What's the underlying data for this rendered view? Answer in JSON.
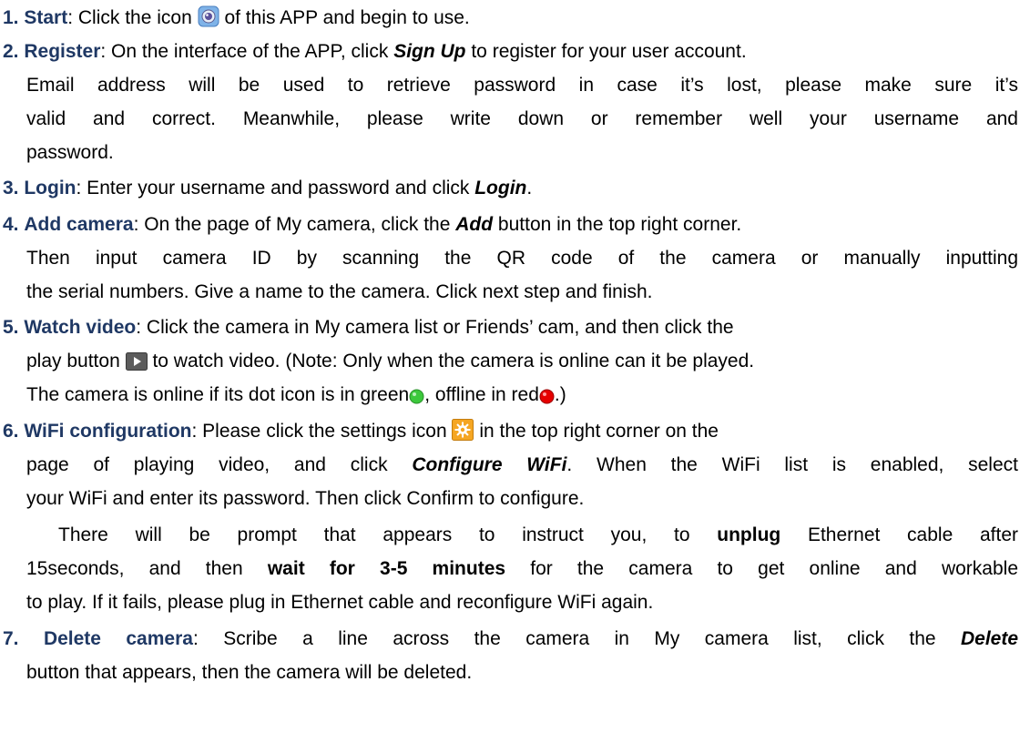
{
  "steps": [
    {
      "num": "1.",
      "label": "Start",
      "text_a": ": Click the icon ",
      "icon": "app-camera-icon",
      "text_b": " of this APP and begin to use."
    },
    {
      "num": "2.",
      "label": "Register",
      "text_a": ": On the interface of the APP, click ",
      "keyword": "Sign Up",
      "text_b": " to register for your user account.",
      "lines": [
        "Email address will be used to retrieve password in case it’s lost, please make sure it’s",
        "valid and correct. Meanwhile, please write down or remember well your username and",
        "password."
      ]
    },
    {
      "num": "3.",
      "label": "Login",
      "text_a": ": Enter your username and password and click ",
      "keyword": "Login",
      "text_b": "."
    },
    {
      "num": "4.",
      "label": "Add camera",
      "text_a": ": On the page of My camera, click the ",
      "keyword": "Add",
      "text_b": " button in the top right corner.",
      "lines": [
        "Then input camera ID by scanning the QR code of the camera or manually inputting",
        "the serial numbers. Give a name to the camera. Click next step and finish."
      ]
    },
    {
      "num": "5.",
      "label": "Watch video",
      "text_a": ": Click the camera in My camera list or Friends’ cam, and then click the",
      "line2_a": "play button ",
      "icon": "play-button-icon",
      "line2_b": " to watch video. (Note: Only when the camera is online can it be played.",
      "line3_a": "The camera is online if its dot icon is in green",
      "icon_green": "green-dot-icon",
      "line3_b": ", offline in red",
      "icon_red": "red-dot-icon",
      "line3_c": ".)"
    },
    {
      "num": "6.",
      "label": "WiFi configuration",
      "text_a": ": Please click the settings icon ",
      "icon": "settings-gear-icon",
      "text_b": " in the top right corner on the",
      "line2_a": "page of playing video, and click ",
      "keyword": "Configure WiFi",
      "line2_b": ". When the WiFi list is enabled, select",
      "line3": "your WiFi and enter its password. Then click Confirm to configure.",
      "para_a": "There will be prompt that appears to instruct you, to ",
      "para_bold1": "unplug",
      "para_b": " Ethernet cable after",
      "para2_a": "15seconds, and then ",
      "para2_bold": "wait for 3-5 minutes",
      "para2_b": " for the camera to get online and workable",
      "para3": "to play. If it fails, please plug in Ethernet cable and reconfigure WiFi again."
    },
    {
      "num": "7.",
      "label": "Delete camera",
      "text_a": ": Scribe a line across the camera in My camera list, click the ",
      "keyword": "Delete",
      "line2": "button that appears, then the camera will be deleted."
    }
  ],
  "colors": {
    "heading": "#1f3864",
    "text": "#000000",
    "online_dot": "#3cc83c",
    "offline_dot": "#e60000",
    "settings_icon": "#f5a623"
  }
}
